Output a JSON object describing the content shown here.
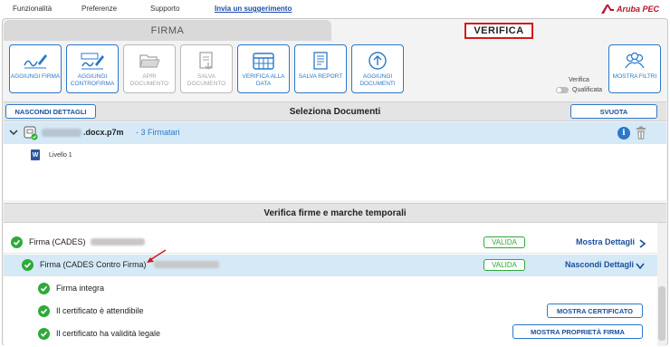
{
  "menu": {
    "items": [
      "Funzionalità",
      "Preferenze",
      "Supporto"
    ],
    "suggestion_link": "Invia un suggerimento",
    "logo_text": "Aruba PEC"
  },
  "tabs": {
    "firma": "FIRMA",
    "verifica": "VERIFICA"
  },
  "toolbar": {
    "buttons": [
      {
        "label": "AGGIUNGI FIRMA",
        "icon": "sign-pen-icon",
        "enabled": true
      },
      {
        "label": "AGGIUNGI CONTROFIRMA",
        "icon": "countersign-pen-icon",
        "enabled": true
      },
      {
        "label": "APRI DOCUMENTO",
        "icon": "folder-open-icon",
        "enabled": false
      },
      {
        "label": "SALVA DOCUMENTO",
        "icon": "save-document-icon",
        "enabled": false
      },
      {
        "label": "VERIFICA ALLA DATA",
        "icon": "calendar-icon",
        "enabled": true
      },
      {
        "label": "SALVA REPORT",
        "icon": "report-icon",
        "enabled": true
      },
      {
        "label": "AGGIUNGI DOCUMENTI",
        "icon": "upload-circle-icon",
        "enabled": true
      },
      {
        "label": "MOSTRA FILTRI",
        "icon": "users-filter-icon",
        "enabled": true
      }
    ],
    "verifica_label": "Verifica",
    "verifica_value": "Qualificata"
  },
  "select_docs": {
    "title": "Seleziona Documenti",
    "hide_details": "NASCONDI DETTAGLI",
    "empty": "SVUOTA"
  },
  "document": {
    "filename_suffix": ".docx.p7m",
    "signers": "- 3 Firmatari",
    "level": "Livello 1",
    "level_icon_letter": "W"
  },
  "verify": {
    "title": "Verifica firme e marche temporali",
    "rows": [
      {
        "label": "Firma (CADES)",
        "status": "VALIDA",
        "action": "Mostra Dettagli"
      },
      {
        "label": "Firma (CADES Contro Firma)",
        "status": "VALIDA",
        "action": "Nascondi Dettagli"
      }
    ],
    "checks": [
      {
        "label": "Firma integra"
      },
      {
        "label": "Il certificato è attendibile",
        "button": "MOSTRA CERTIFICATO"
      },
      {
        "label": "Il certificato ha validità legale",
        "button": "MOSTRA PROPRIETÀ FIRMA"
      }
    ]
  },
  "colors": {
    "accent": "#2c78c9",
    "valid_green": "#2eaa3a",
    "highlight_blue": "#d5e9f7",
    "brand_red": "#b3132b",
    "annotation_red": "#d11b1b"
  }
}
